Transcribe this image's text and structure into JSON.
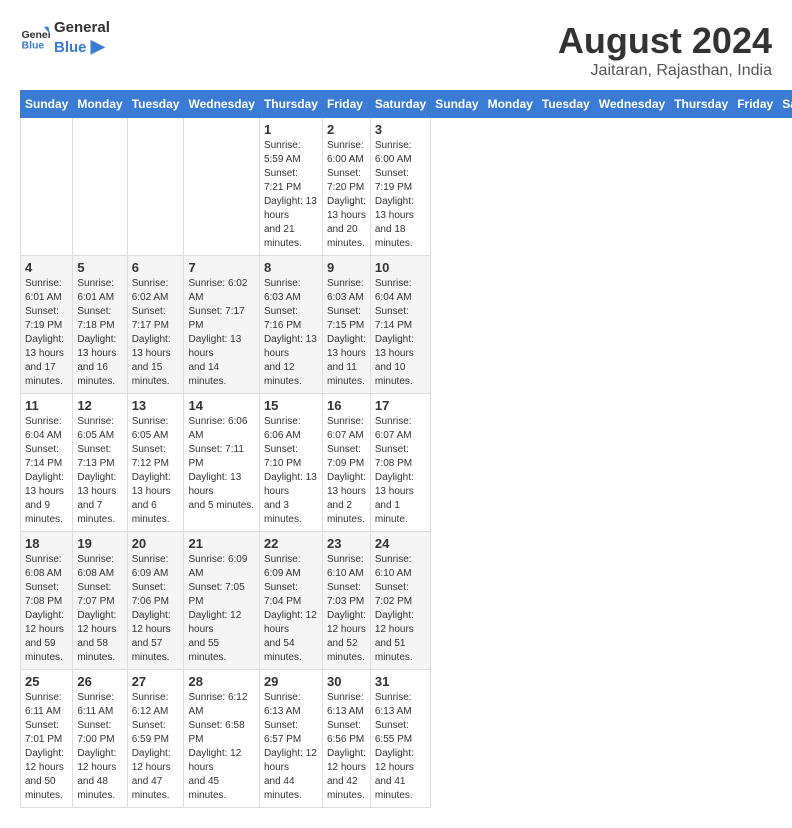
{
  "logo": {
    "text_general": "General",
    "text_blue": "Blue"
  },
  "title": {
    "month_year": "August 2024",
    "location": "Jaitaran, Rajasthan, India"
  },
  "days_of_week": [
    "Sunday",
    "Monday",
    "Tuesday",
    "Wednesday",
    "Thursday",
    "Friday",
    "Saturday"
  ],
  "weeks": [
    [
      {
        "day": "",
        "info": ""
      },
      {
        "day": "",
        "info": ""
      },
      {
        "day": "",
        "info": ""
      },
      {
        "day": "",
        "info": ""
      },
      {
        "day": "1",
        "info": "Sunrise: 5:59 AM\nSunset: 7:21 PM\nDaylight: 13 hours\nand 21 minutes."
      },
      {
        "day": "2",
        "info": "Sunrise: 6:00 AM\nSunset: 7:20 PM\nDaylight: 13 hours\nand 20 minutes."
      },
      {
        "day": "3",
        "info": "Sunrise: 6:00 AM\nSunset: 7:19 PM\nDaylight: 13 hours\nand 18 minutes."
      }
    ],
    [
      {
        "day": "4",
        "info": "Sunrise: 6:01 AM\nSunset: 7:19 PM\nDaylight: 13 hours\nand 17 minutes."
      },
      {
        "day": "5",
        "info": "Sunrise: 6:01 AM\nSunset: 7:18 PM\nDaylight: 13 hours\nand 16 minutes."
      },
      {
        "day": "6",
        "info": "Sunrise: 6:02 AM\nSunset: 7:17 PM\nDaylight: 13 hours\nand 15 minutes."
      },
      {
        "day": "7",
        "info": "Sunrise: 6:02 AM\nSunset: 7:17 PM\nDaylight: 13 hours\nand 14 minutes."
      },
      {
        "day": "8",
        "info": "Sunrise: 6:03 AM\nSunset: 7:16 PM\nDaylight: 13 hours\nand 12 minutes."
      },
      {
        "day": "9",
        "info": "Sunrise: 6:03 AM\nSunset: 7:15 PM\nDaylight: 13 hours\nand 11 minutes."
      },
      {
        "day": "10",
        "info": "Sunrise: 6:04 AM\nSunset: 7:14 PM\nDaylight: 13 hours\nand 10 minutes."
      }
    ],
    [
      {
        "day": "11",
        "info": "Sunrise: 6:04 AM\nSunset: 7:14 PM\nDaylight: 13 hours\nand 9 minutes."
      },
      {
        "day": "12",
        "info": "Sunrise: 6:05 AM\nSunset: 7:13 PM\nDaylight: 13 hours\nand 7 minutes."
      },
      {
        "day": "13",
        "info": "Sunrise: 6:05 AM\nSunset: 7:12 PM\nDaylight: 13 hours\nand 6 minutes."
      },
      {
        "day": "14",
        "info": "Sunrise: 6:06 AM\nSunset: 7:11 PM\nDaylight: 13 hours\nand 5 minutes."
      },
      {
        "day": "15",
        "info": "Sunrise: 6:06 AM\nSunset: 7:10 PM\nDaylight: 13 hours\nand 3 minutes."
      },
      {
        "day": "16",
        "info": "Sunrise: 6:07 AM\nSunset: 7:09 PM\nDaylight: 13 hours\nand 2 minutes."
      },
      {
        "day": "17",
        "info": "Sunrise: 6:07 AM\nSunset: 7:08 PM\nDaylight: 13 hours\nand 1 minute."
      }
    ],
    [
      {
        "day": "18",
        "info": "Sunrise: 6:08 AM\nSunset: 7:08 PM\nDaylight: 12 hours\nand 59 minutes."
      },
      {
        "day": "19",
        "info": "Sunrise: 6:08 AM\nSunset: 7:07 PM\nDaylight: 12 hours\nand 58 minutes."
      },
      {
        "day": "20",
        "info": "Sunrise: 6:09 AM\nSunset: 7:06 PM\nDaylight: 12 hours\nand 57 minutes."
      },
      {
        "day": "21",
        "info": "Sunrise: 6:09 AM\nSunset: 7:05 PM\nDaylight: 12 hours\nand 55 minutes."
      },
      {
        "day": "22",
        "info": "Sunrise: 6:09 AM\nSunset: 7:04 PM\nDaylight: 12 hours\nand 54 minutes."
      },
      {
        "day": "23",
        "info": "Sunrise: 6:10 AM\nSunset: 7:03 PM\nDaylight: 12 hours\nand 52 minutes."
      },
      {
        "day": "24",
        "info": "Sunrise: 6:10 AM\nSunset: 7:02 PM\nDaylight: 12 hours\nand 51 minutes."
      }
    ],
    [
      {
        "day": "25",
        "info": "Sunrise: 6:11 AM\nSunset: 7:01 PM\nDaylight: 12 hours\nand 50 minutes."
      },
      {
        "day": "26",
        "info": "Sunrise: 6:11 AM\nSunset: 7:00 PM\nDaylight: 12 hours\nand 48 minutes."
      },
      {
        "day": "27",
        "info": "Sunrise: 6:12 AM\nSunset: 6:59 PM\nDaylight: 12 hours\nand 47 minutes."
      },
      {
        "day": "28",
        "info": "Sunrise: 6:12 AM\nSunset: 6:58 PM\nDaylight: 12 hours\nand 45 minutes."
      },
      {
        "day": "29",
        "info": "Sunrise: 6:13 AM\nSunset: 6:57 PM\nDaylight: 12 hours\nand 44 minutes."
      },
      {
        "day": "30",
        "info": "Sunrise: 6:13 AM\nSunset: 6:56 PM\nDaylight: 12 hours\nand 42 minutes."
      },
      {
        "day": "31",
        "info": "Sunrise: 6:13 AM\nSunset: 6:55 PM\nDaylight: 12 hours\nand 41 minutes."
      }
    ]
  ]
}
